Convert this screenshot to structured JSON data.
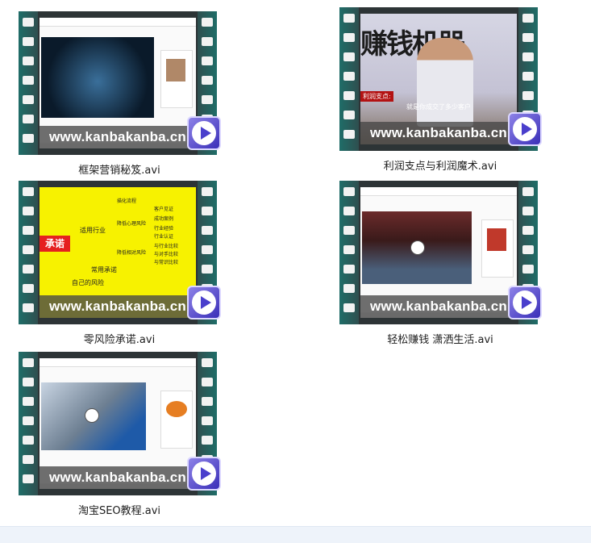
{
  "watermark": "www.kanbakanba.cn",
  "files": [
    {
      "name": "框架营销秘笈.avi",
      "thumb": "web-dark"
    },
    {
      "name": "利润支点与利润魔术.avi",
      "thumb": "lecture",
      "banner": "赚钱机器",
      "label": "利润支点:",
      "subtitle": "就是你成交了多少客户"
    },
    {
      "name": "零风险承诺.avi",
      "thumb": "mindmap",
      "center": "承诺",
      "nodes": [
        "适用行业",
        "常用承诺",
        "自己的风险",
        "描化流程",
        "降低心理风险",
        "降低相对风险",
        "客户见证",
        "成功案例",
        "行业经验",
        "行业认证",
        "与行业比较",
        "与对手比较",
        "与常识比较"
      ]
    },
    {
      "name": "轻松赚钱 潇洒生活.avi",
      "thumb": "web-hall"
    },
    {
      "name": "淘宝SEO教程.avi",
      "thumb": "web-video"
    }
  ],
  "icons": {
    "play": "play-icon",
    "film": "film-strip-icon"
  },
  "colors": {
    "accent": "#4a3fcc",
    "film": "#2d3436",
    "map": "#f7f200"
  }
}
